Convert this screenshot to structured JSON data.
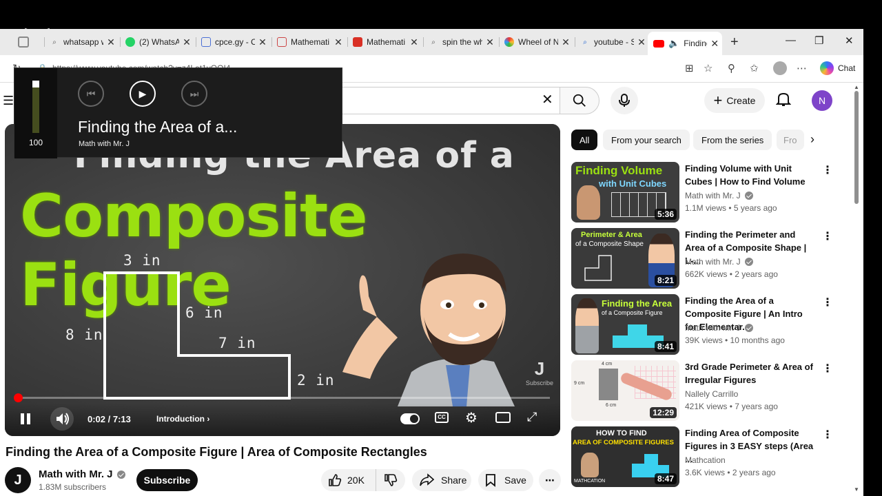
{
  "browser": {
    "tabs": [
      {
        "title": "whatsapp w",
        "fav": "search",
        "active": false
      },
      {
        "title": "(2) WhatsA",
        "fav": "whatsapp",
        "active": false
      },
      {
        "title": "cpce.gy - C",
        "fav": "doc",
        "active": false
      },
      {
        "title": "Mathemati",
        "fav": "doc",
        "active": false
      },
      {
        "title": "Mathemati",
        "fav": "pdf",
        "active": false
      },
      {
        "title": "spin the wh",
        "fav": "search",
        "active": false
      },
      {
        "title": "Wheel of N",
        "fav": "wheel",
        "active": false
      },
      {
        "title": "youtube - S",
        "fav": "search",
        "active": false
      },
      {
        "title": "Finding",
        "fav": "youtube",
        "active": true
      }
    ],
    "url": "https://www.youtube.com/watch?v=z4Lat1yOOI4",
    "chat_label": "Chat"
  },
  "media_overlay": {
    "volume": 100,
    "title": "Finding the Area of a...",
    "channel": "Math with Mr. J"
  },
  "header": {
    "create_label": "Create",
    "avatar_letter": "N"
  },
  "player": {
    "thumb_line1": "Finding the Area of a",
    "thumb_line2": "Composite Figure",
    "dims": {
      "top": "3 in",
      "left": "8 in",
      "inner_v": "6 in",
      "inner_h": "7 in",
      "right": "2 in"
    },
    "watermark": "Subscribe",
    "time": "0:02 / 7:13",
    "chapter": "Introduction",
    "progress": 0.005
  },
  "video": {
    "title": "Finding the Area of a Composite Figure | Area of Composite Rectangles",
    "channel": "Math with Mr. J",
    "subscribers": "1.83M subscribers",
    "subscribe_label": "Subscribe",
    "likes": "20K",
    "share_label": "Share",
    "save_label": "Save"
  },
  "sidebar": {
    "chips": [
      "All",
      "From your search",
      "From the series",
      "Fro"
    ],
    "recommendations": [
      {
        "title": "Finding Volume with Unit Cubes | How to Find Volume",
        "channel": "Math with Mr. J",
        "verified": true,
        "meta": "1.1M views • 5 years ago",
        "duration": "5:36",
        "thumb_text": [
          "Finding Volume",
          "with Unit Cubes"
        ]
      },
      {
        "title": "Finding the Perimeter and Area of a Composite Shape | L-...",
        "channel": "Math with Mr. J",
        "verified": true,
        "meta": "662K views • 2 years ago",
        "duration": "8:21",
        "thumb_text": [
          "Perimeter & Area",
          "of a Composite Shape"
        ]
      },
      {
        "title": "Finding the Area of a Composite Figure | An Intro for Elementar...",
        "channel": "Math with Mr. J",
        "verified": true,
        "meta": "39K views • 10 months ago",
        "duration": "8:41",
        "thumb_text": [
          "Finding the Area",
          "of a Composite Figure"
        ]
      },
      {
        "title": "3rd Grade Perimeter & Area of Irregular Figures",
        "channel": "Nallely Carrillo",
        "verified": false,
        "meta": "421K views • 7 years ago",
        "duration": "12:29",
        "thumb_text": [
          "4 cm",
          "9 cm",
          "6 cm"
        ]
      },
      {
        "title": "Finding Area of Composite Figures in 3 EASY steps (Area ...",
        "channel": "Mathcation",
        "verified": false,
        "meta": "3.6K views • 2 years ago",
        "duration": "8:47",
        "thumb_text": [
          "HOW TO FIND",
          "AREA OF COMPOSITE FIGURES",
          "MATHCATION"
        ]
      }
    ]
  },
  "colors": {
    "accent_red": "#ff0000",
    "thumb_green": "#9be011",
    "avatar_purple": "#7e44c9"
  }
}
